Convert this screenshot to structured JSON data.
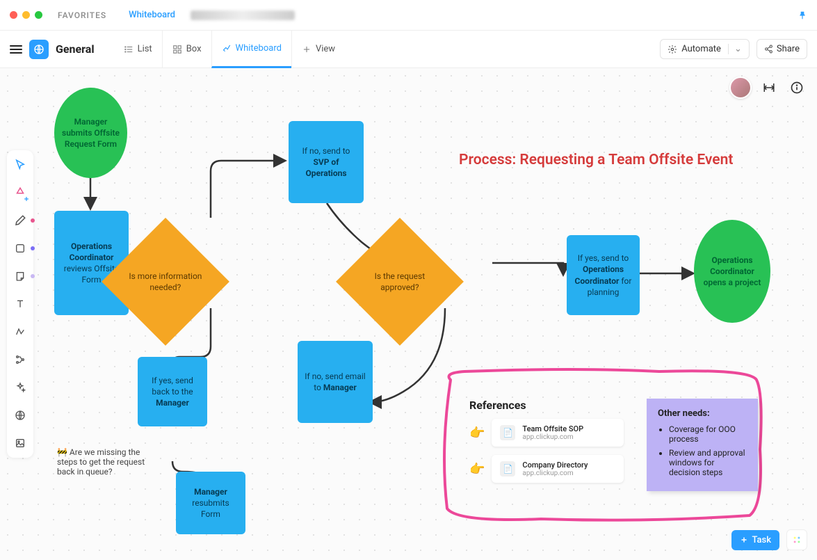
{
  "topbar": {
    "favorites_label": "FAVORITES",
    "crumb_whiteboard": "Whiteboard"
  },
  "header": {
    "space_name": "General",
    "tabs": [
      {
        "label": "List"
      },
      {
        "label": "Box"
      },
      {
        "label": "Whiteboard"
      },
      {
        "label": "View"
      }
    ],
    "automate_label": "Automate",
    "share_label": "Share"
  },
  "flow": {
    "title": "Process: Requesting a Team Offsite Event",
    "start": {
      "l1": "Manager submits Offsite Request Form"
    },
    "review": {
      "l1": "Operations Coordinator",
      "l2": " reviews Offsite Form"
    },
    "decision1": "Is more information needed?",
    "yes_back": {
      "l1": "If yes, send back to the ",
      "bold": "Manager"
    },
    "resubmit": {
      "bold": "Manager",
      "l2": " resubmits Form"
    },
    "no_svp": {
      "l1": "If no, send to ",
      "bold": "SVP of Operations"
    },
    "decision2": "Is the request approved?",
    "no_email": {
      "l1": "If no, send email to ",
      "bold": "Manager"
    },
    "yes_plan": {
      "l1": "If yes, send to ",
      "bold": "Operations Coordinator",
      "l2": " for planning"
    },
    "end": {
      "bold": "Operations Coordinator",
      "l2": " opens a project"
    }
  },
  "comment": "🚧 Are we missing the steps to get the request back in queue?",
  "refs": {
    "title": "References",
    "items": [
      {
        "emoji": "👉",
        "title": "Team Offsite SOP",
        "sub": "app.clickup.com"
      },
      {
        "emoji": "👉",
        "title": "Company Directory",
        "sub": "app.clickup.com"
      }
    ]
  },
  "sticky": {
    "heading": "Other needs:",
    "items": [
      "Coverage for OOO process",
      "Review and approval windows for decision steps"
    ]
  },
  "task_button": "Task"
}
